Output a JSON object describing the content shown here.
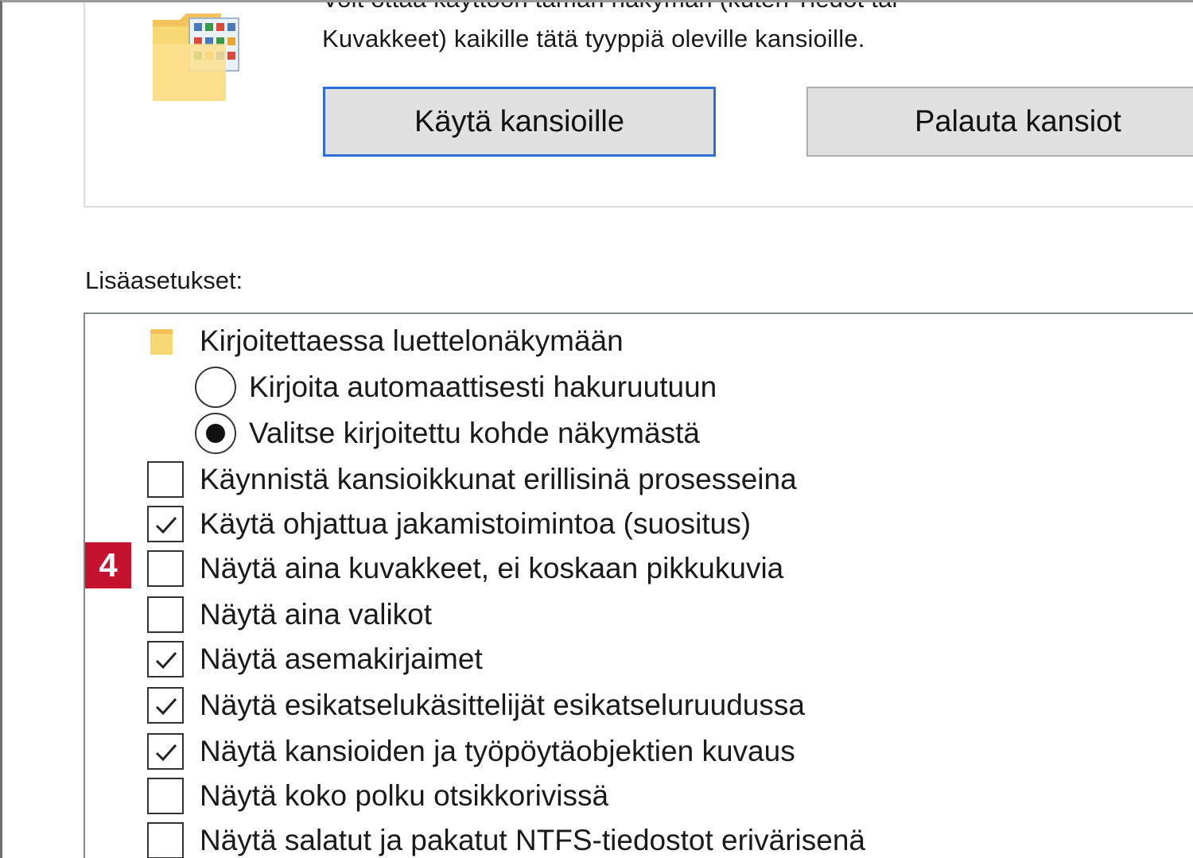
{
  "colors": {
    "accent_focus": "#2e6fd6",
    "badge": "#c4122f",
    "folder_yellow": "#f8d775",
    "button_face": "#e1e1e1"
  },
  "folder_views": {
    "description_line1": "Voit ottaa käyttöön tämän näkymän (kuten Tiedot tai",
    "description_line2": "Kuvakkeet) kaikille tätä tyyppiä oleville kansioille.",
    "apply_button": "Käytä kansioille",
    "reset_button": "Palauta kansiot"
  },
  "advanced": {
    "label": "Lisäasetukset:",
    "group_label": "Kirjoitettaessa luettelonäkymään",
    "radios": [
      {
        "label": "Kirjoita automaattisesti hakuruutuun",
        "selected": false
      },
      {
        "label": "Valitse kirjoitettu kohde näkymästä",
        "selected": true
      }
    ],
    "checkboxes": [
      {
        "label": "Käynnistä kansioikkunat erillisinä prosesseina",
        "checked": false
      },
      {
        "label": "Käytä ohjattua jakamistoimintoa (suositus)",
        "checked": true
      },
      {
        "label": "Näytä aina kuvakkeet, ei koskaan pikkukuvia",
        "checked": false
      },
      {
        "label": "Näytä aina valikot",
        "checked": false
      },
      {
        "label": "Näytä asemakirjaimet",
        "checked": true
      },
      {
        "label": "Näytä esikatselukäsittelijät esikatseluruudussa",
        "checked": true
      },
      {
        "label": "Näytä kansioiden ja työpöytäobjektien kuvaus",
        "checked": true
      },
      {
        "label": "Näytä koko polku otsikkorivissä",
        "checked": false
      },
      {
        "label": "Näytä salatut ja pakatut NTFS-tiedostot erivärisenä",
        "checked": false
      }
    ]
  },
  "annotation": {
    "badge_number": "4"
  }
}
